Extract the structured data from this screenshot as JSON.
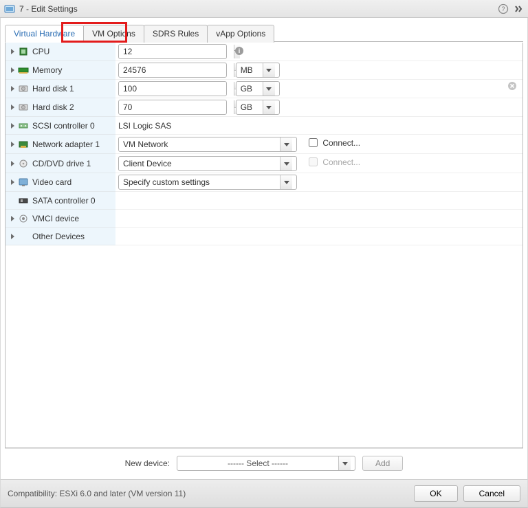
{
  "title_prefix": "7 - Edit Settings",
  "tabs": {
    "virtual_hardware": "Virtual Hardware",
    "vm_options": "VM Options",
    "sdrs_rules": "SDRS Rules",
    "vapp_options": "vApp Options"
  },
  "rows": {
    "cpu": {
      "label": "CPU",
      "value": "12"
    },
    "memory": {
      "label": "Memory",
      "value": "24576",
      "unit": "MB"
    },
    "hd1": {
      "label": "Hard disk 1",
      "value": "100",
      "unit": "GB"
    },
    "hd2": {
      "label": "Hard disk 2",
      "value": "70",
      "unit": "GB"
    },
    "scsi": {
      "label": "SCSI controller 0",
      "value": "LSI Logic SAS"
    },
    "net1": {
      "label": "Network adapter 1",
      "value": "VM Network",
      "connect": "Connect..."
    },
    "cd1": {
      "label": "CD/DVD drive 1",
      "value": "Client Device",
      "connect": "Connect..."
    },
    "video": {
      "label": "Video card",
      "value": "Specify custom settings"
    },
    "sata0": {
      "label": "SATA controller 0"
    },
    "vmci": {
      "label": "VMCI device"
    },
    "other": {
      "label": "Other Devices"
    }
  },
  "new_device": {
    "label": "New device:",
    "placeholder": "------ Select ------",
    "add": "Add"
  },
  "footer": {
    "compat": "Compatibility: ESXi 6.0 and later (VM version 11)",
    "ok": "OK",
    "cancel": "Cancel"
  }
}
